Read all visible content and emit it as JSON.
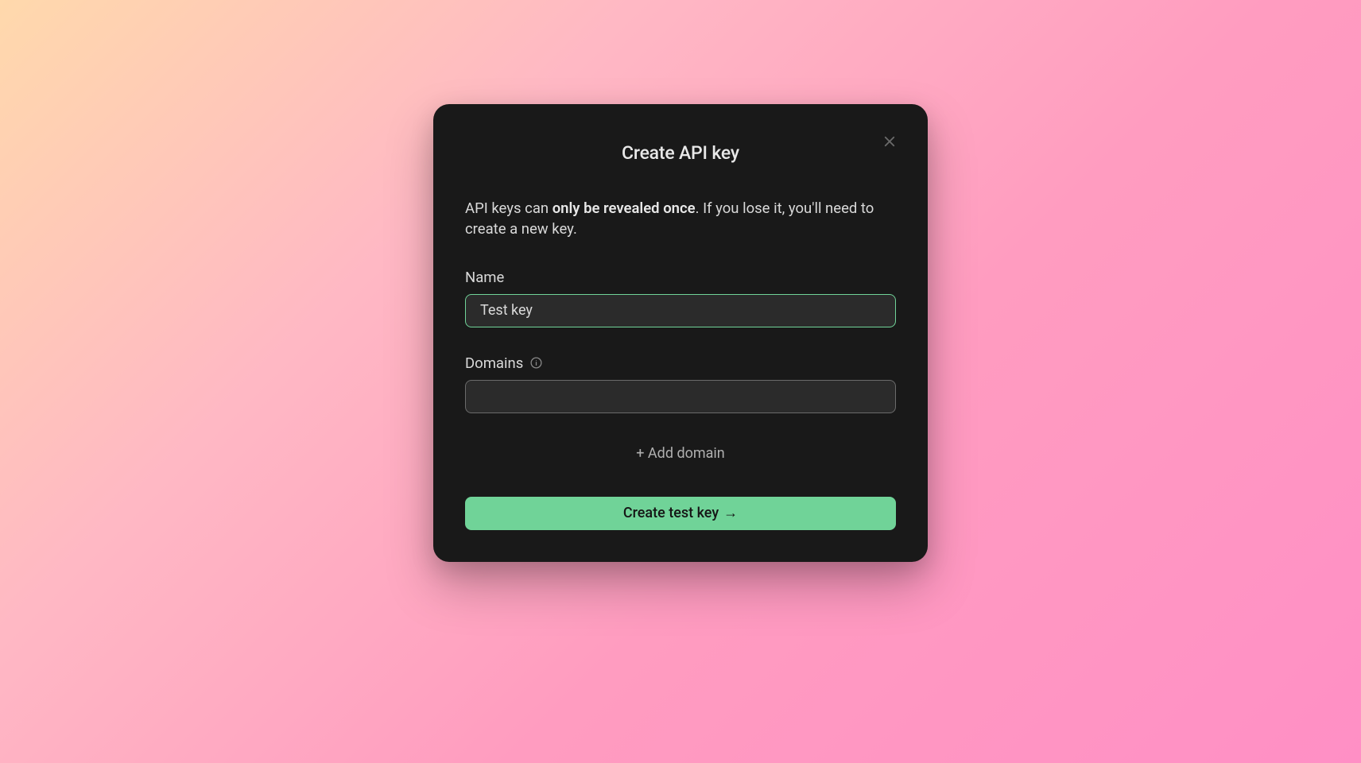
{
  "modal": {
    "title": "Create API key",
    "warning_prefix": "API keys can ",
    "warning_bold": "only be revealed once",
    "warning_suffix": ". If you lose it, you'll need to create a new key.",
    "name_label": "Name",
    "name_value": "Test key",
    "domains_label": "Domains",
    "domains_value": "",
    "add_domain_label": "+ Add domain",
    "create_button_label": "Create test key",
    "create_button_arrow": "→"
  }
}
